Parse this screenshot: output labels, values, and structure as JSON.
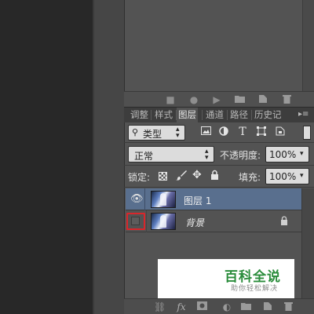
{
  "panel_tabs": [
    "调整",
    "样式",
    "图层",
    "通道",
    "路径",
    "历史记"
  ],
  "filter": {
    "kind_label": "类型"
  },
  "blend": {
    "mode": "正常",
    "opacity_label": "不透明度:",
    "opacity_value": "100%"
  },
  "lock": {
    "label": "锁定:",
    "fill_label": "填充:",
    "fill_value": "100%"
  },
  "layers": [
    {
      "name": "图层 1",
      "visible": true,
      "selected": true
    },
    {
      "name": "背景",
      "visible": false,
      "selected": false,
      "locked": true
    }
  ],
  "watermark": {
    "title": "百科全说",
    "subtitle": "助你轻松解决"
  },
  "colors": {
    "highlight": "#d9262b",
    "selected_row": "#596f8e",
    "watermark_green": "#2a8c3b"
  }
}
